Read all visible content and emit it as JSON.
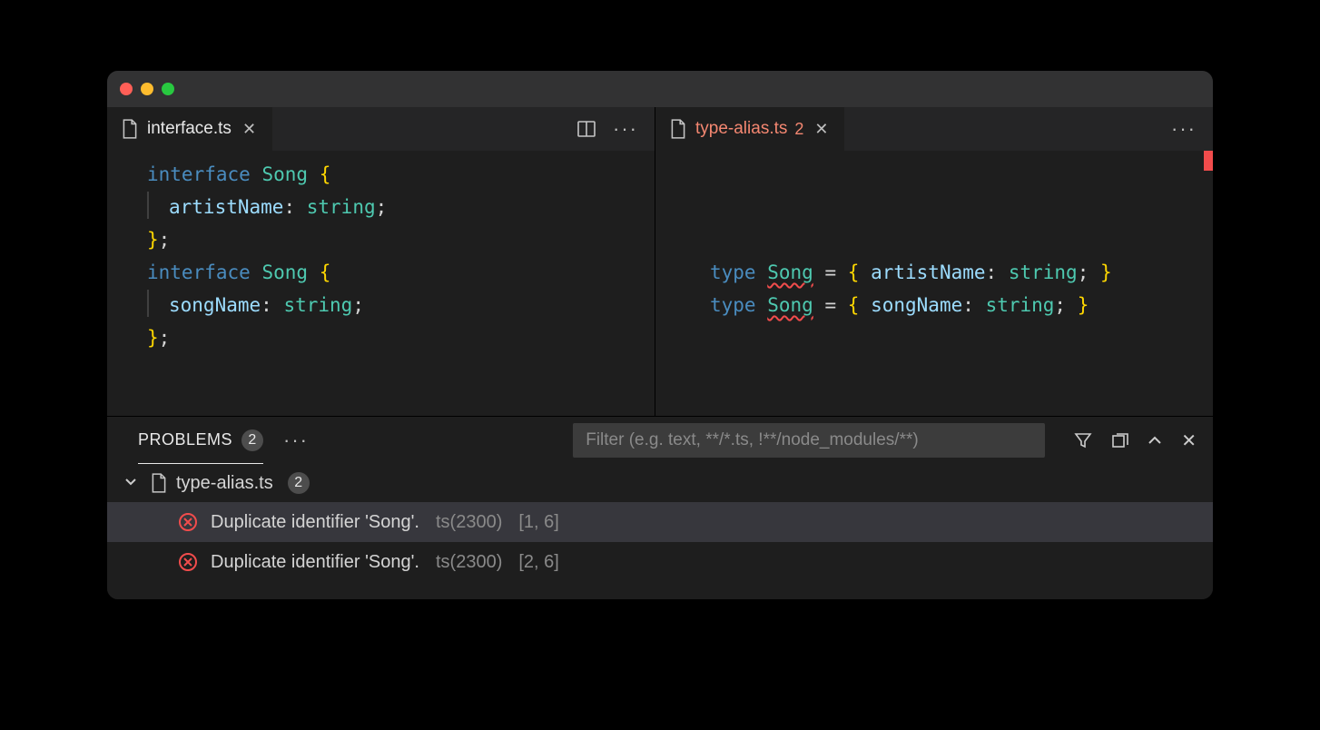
{
  "left_tab": {
    "filename": "interface.ts"
  },
  "right_tab": {
    "filename": "type-alias.ts",
    "error_count": "2"
  },
  "left_code_tokens": [
    [
      [
        "kw",
        "interface"
      ],
      [
        "sp",
        " "
      ],
      [
        "typ",
        "Song"
      ],
      [
        "sp",
        " "
      ],
      [
        "br",
        "{"
      ]
    ],
    [
      [
        "guide",
        ""
      ],
      [
        "prop",
        "artistName"
      ],
      [
        "punc",
        ":"
      ],
      [
        "sp",
        " "
      ],
      [
        "str",
        "string"
      ],
      [
        "punc",
        ";"
      ]
    ],
    [
      [
        "br",
        "}"
      ],
      [
        "punc",
        ";"
      ]
    ],
    [
      [
        "kw",
        "interface"
      ],
      [
        "sp",
        " "
      ],
      [
        "typ",
        "Song"
      ],
      [
        "sp",
        " "
      ],
      [
        "br",
        "{"
      ]
    ],
    [
      [
        "guide",
        ""
      ],
      [
        "prop",
        "songName"
      ],
      [
        "punc",
        ":"
      ],
      [
        "sp",
        " "
      ],
      [
        "str",
        "string"
      ],
      [
        "punc",
        ";"
      ]
    ],
    [
      [
        "br",
        "}"
      ],
      [
        "punc",
        ";"
      ]
    ]
  ],
  "right_code_tokens": [
    [
      [
        "kw",
        "type"
      ],
      [
        "sp",
        " "
      ],
      [
        "typ squiggle",
        "Song"
      ],
      [
        "sp",
        " "
      ],
      [
        "op",
        "="
      ],
      [
        "sp",
        " "
      ],
      [
        "br",
        "{"
      ],
      [
        "sp",
        " "
      ],
      [
        "prop",
        "artistName"
      ],
      [
        "punc",
        ":"
      ],
      [
        "sp",
        " "
      ],
      [
        "str",
        "string"
      ],
      [
        "punc",
        ";"
      ],
      [
        "sp",
        " "
      ],
      [
        "br",
        "}"
      ]
    ],
    [
      [
        "kw",
        "type"
      ],
      [
        "sp",
        " "
      ],
      [
        "typ squiggle",
        "Song"
      ],
      [
        "sp",
        " "
      ],
      [
        "op",
        "="
      ],
      [
        "sp",
        " "
      ],
      [
        "br",
        "{"
      ],
      [
        "sp",
        " "
      ],
      [
        "prop",
        "songName"
      ],
      [
        "punc",
        ":"
      ],
      [
        "sp",
        " "
      ],
      [
        "str",
        "string"
      ],
      [
        "punc",
        ";"
      ],
      [
        "sp",
        " "
      ],
      [
        "br",
        "}"
      ]
    ]
  ],
  "panel": {
    "tab_label": "PROBLEMS",
    "badge": "2",
    "filter_placeholder": "Filter (e.g. text, **/*.ts, !**/node_modules/**)"
  },
  "problems": {
    "file": "type-alias.ts",
    "count": "2",
    "items": [
      {
        "msg": "Duplicate identifier 'Song'.",
        "code": "ts(2300)",
        "loc": "[1, 6]"
      },
      {
        "msg": "Duplicate identifier 'Song'.",
        "code": "ts(2300)",
        "loc": "[2, 6]"
      }
    ]
  }
}
